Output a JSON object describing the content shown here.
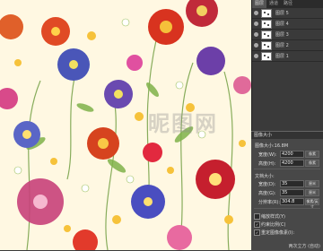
{
  "panel": {
    "tabs": [
      "图层",
      "通道",
      "路径"
    ],
    "layers": [
      {
        "name": "图层 5"
      },
      {
        "name": "图层 4"
      },
      {
        "name": "图层 3"
      },
      {
        "name": "图层 2"
      },
      {
        "name": "图层 1"
      }
    ]
  },
  "dialog": {
    "title": "图像大小",
    "size_label": "图像大小:16.8M",
    "width_label": "宽度(W):",
    "width_value": "4200",
    "width_unit": "像素",
    "height_label": "高度(H):",
    "height_value": "4200",
    "height_unit": "像素",
    "doc_size_label": "文档大小:",
    "doc_width_label": "宽度(D):",
    "doc_width_value": "35",
    "doc_width_unit": "厘米",
    "doc_height_label": "高度(G):",
    "doc_height_value": "35",
    "doc_height_unit": "厘米",
    "resolution_label": "分辨率(R):",
    "resolution_value": "304.8",
    "resolution_unit": "像素/英寸",
    "scale_styles": "缩放样式(Y)",
    "constrain": "约束比例(C)",
    "resample": "重定图像像素(I):",
    "footer": "两次立方 (自动)"
  },
  "watermark": "昵图网"
}
